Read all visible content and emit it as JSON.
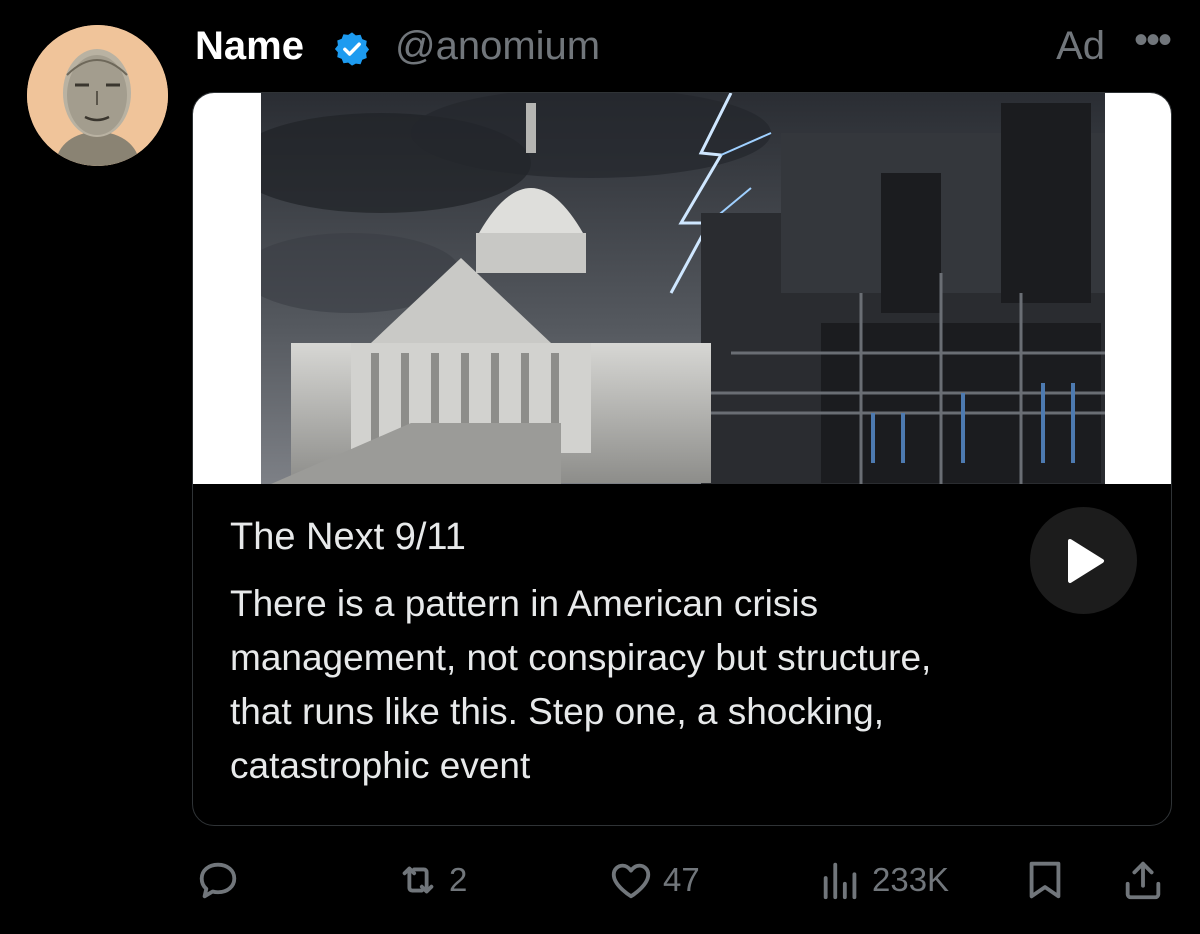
{
  "author": {
    "name": "Name",
    "handle": "@anomium",
    "verified_icon": "verified-badge-icon",
    "ad_label": "Ad",
    "more_label": "•••"
  },
  "card": {
    "title": "The Next 9/11",
    "body": "There is a pattern in American crisis management, not conspiracy but structure, that runs like this. Step one, a shocking, catastrophic event",
    "media_icon": "play-icon"
  },
  "actions": {
    "reply": {
      "icon": "reply-icon",
      "count": ""
    },
    "repost": {
      "icon": "repost-icon",
      "count": "2"
    },
    "like": {
      "icon": "heart-icon",
      "count": "47"
    },
    "views": {
      "icon": "views-icon",
      "count": "233K"
    },
    "bookmark": {
      "icon": "bookmark-icon"
    },
    "share": {
      "icon": "share-icon"
    }
  },
  "colors": {
    "background": "#000000",
    "text": "#e7e9ea",
    "muted": "#71767b",
    "verified": "#1d9bf0",
    "avatar_bg": "#f0c49a"
  }
}
